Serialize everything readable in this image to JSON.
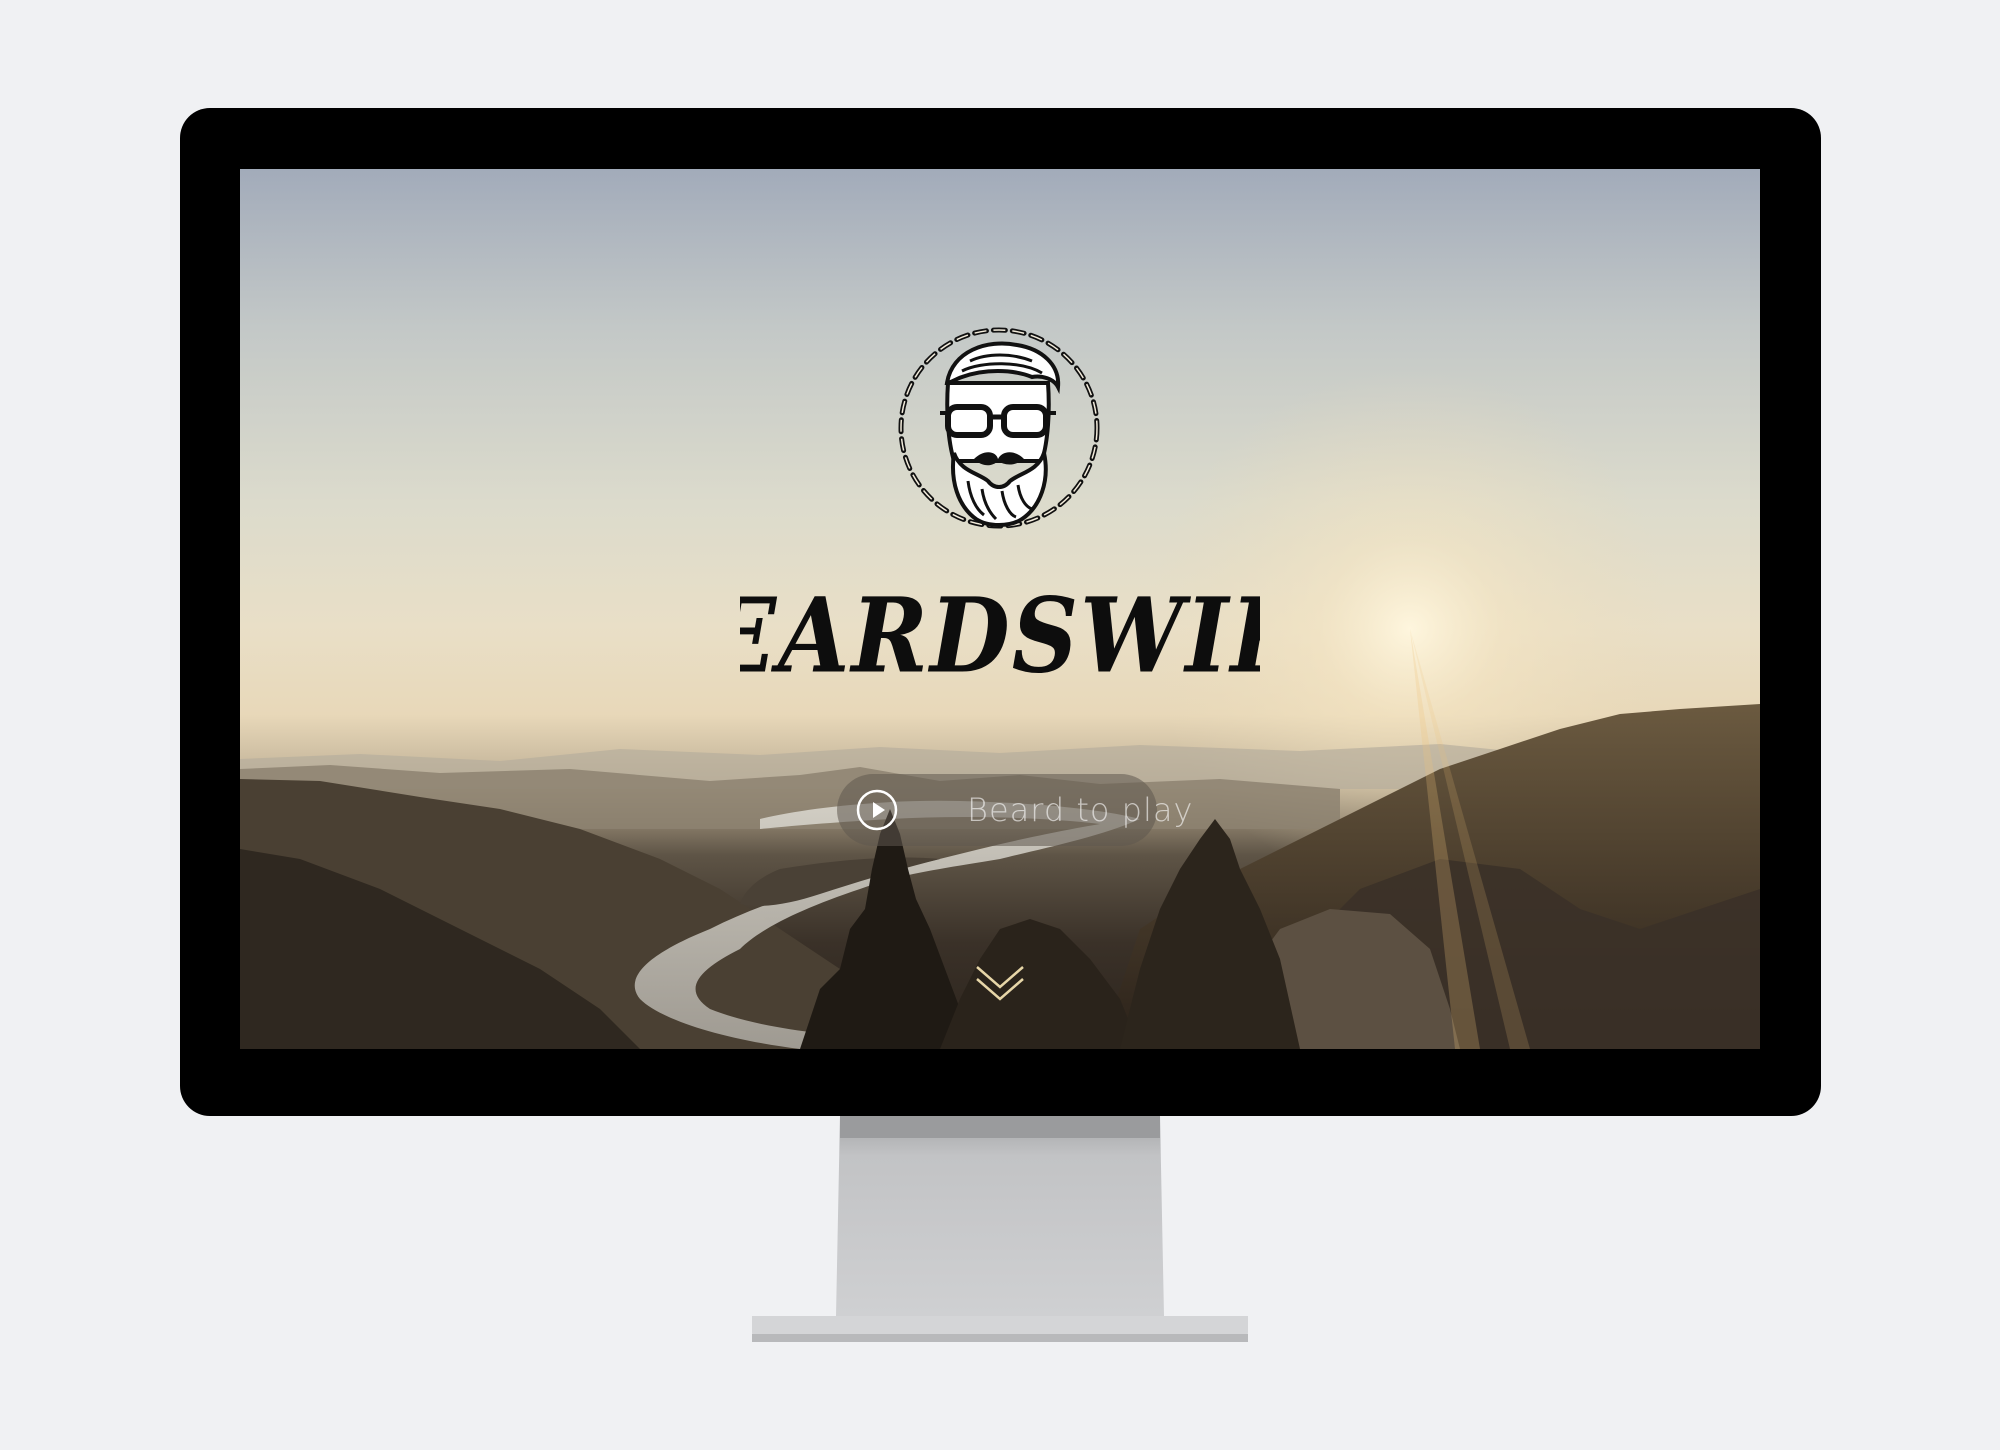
{
  "page": {
    "background_color": "#f0f1f3"
  },
  "device": {
    "type": "desktop monitor",
    "bezel_color": "#000000",
    "stand_color": "#c8c9cb"
  },
  "site": {
    "brand_name": "BEARDSWIPE",
    "logo_icon": "bearded-man-glasses-icon",
    "play_button": {
      "icon": "play-circle-icon",
      "label": "Beard to play"
    },
    "scroll_icon": "double-chevron-down-icon",
    "hero_background": "sunset mountain valley with river"
  }
}
